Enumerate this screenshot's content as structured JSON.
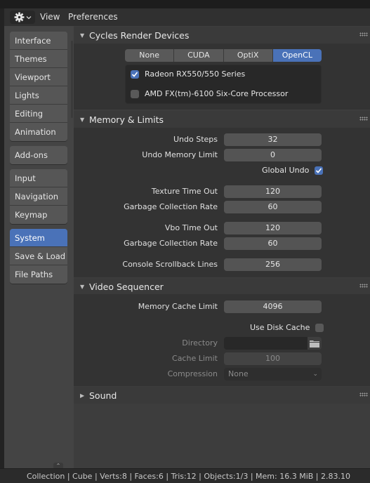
{
  "header": {
    "menu": [
      {
        "label": "View"
      },
      {
        "label": "Preferences"
      }
    ],
    "editor_icon": "gear-icon"
  },
  "sidebar": {
    "groups": [
      [
        {
          "label": "Interface"
        },
        {
          "label": "Themes"
        },
        {
          "label": "Viewport"
        },
        {
          "label": "Lights"
        },
        {
          "label": "Editing"
        },
        {
          "label": "Animation"
        }
      ],
      [
        {
          "label": "Add-ons"
        }
      ],
      [
        {
          "label": "Input"
        },
        {
          "label": "Navigation"
        },
        {
          "label": "Keymap"
        }
      ],
      [
        {
          "label": "System",
          "active": true
        },
        {
          "label": "Save & Load"
        },
        {
          "label": "File Paths"
        }
      ]
    ]
  },
  "cycles": {
    "title": "Cycles Render Devices",
    "expanded": true,
    "tabs": [
      {
        "label": "None"
      },
      {
        "label": "CUDA"
      },
      {
        "label": "OptiX"
      },
      {
        "label": "OpenCL",
        "active": true
      }
    ],
    "devices": [
      {
        "label": "Radeon RX550/550 Series",
        "checked": true
      },
      {
        "label": "AMD FX(tm)-6100 Six-Core Processor",
        "checked": false
      }
    ]
  },
  "memory": {
    "title": "Memory & Limits",
    "expanded": true,
    "undo_steps": {
      "label": "Undo Steps",
      "value": "32"
    },
    "undo_memory_limit": {
      "label": "Undo Memory Limit",
      "value": "0"
    },
    "global_undo": {
      "label": "Global Undo",
      "checked": true
    },
    "texture_time_out": {
      "label": "Texture Time Out",
      "value": "120"
    },
    "texture_gc_rate": {
      "label": "Garbage Collection Rate",
      "value": "60"
    },
    "vbo_time_out": {
      "label": "Vbo Time Out",
      "value": "120"
    },
    "vbo_gc_rate": {
      "label": "Garbage Collection Rate",
      "value": "60"
    },
    "console_scrollback": {
      "label": "Console Scrollback Lines",
      "value": "256"
    }
  },
  "video": {
    "title": "Video Sequencer",
    "expanded": true,
    "memory_cache_limit": {
      "label": "Memory Cache Limit",
      "value": "4096"
    },
    "use_disk_cache": {
      "label": "Use Disk Cache",
      "checked": false
    },
    "directory": {
      "label": "Directory",
      "value": ""
    },
    "cache_limit": {
      "label": "Cache Limit",
      "value": "100"
    },
    "compression": {
      "label": "Compression",
      "value": "None"
    }
  },
  "sound": {
    "title": "Sound",
    "expanded": false
  },
  "statusbar": {
    "text": "Collection | Cube | Verts:8 | Faces:6 | Tris:12 | Objects:1/3 | Mem: 16.3 MiB | 2.83.10"
  },
  "colors": {
    "accent": "#4a72b8",
    "panel_bg": "#333333",
    "sidebar_bg": "#444444"
  }
}
